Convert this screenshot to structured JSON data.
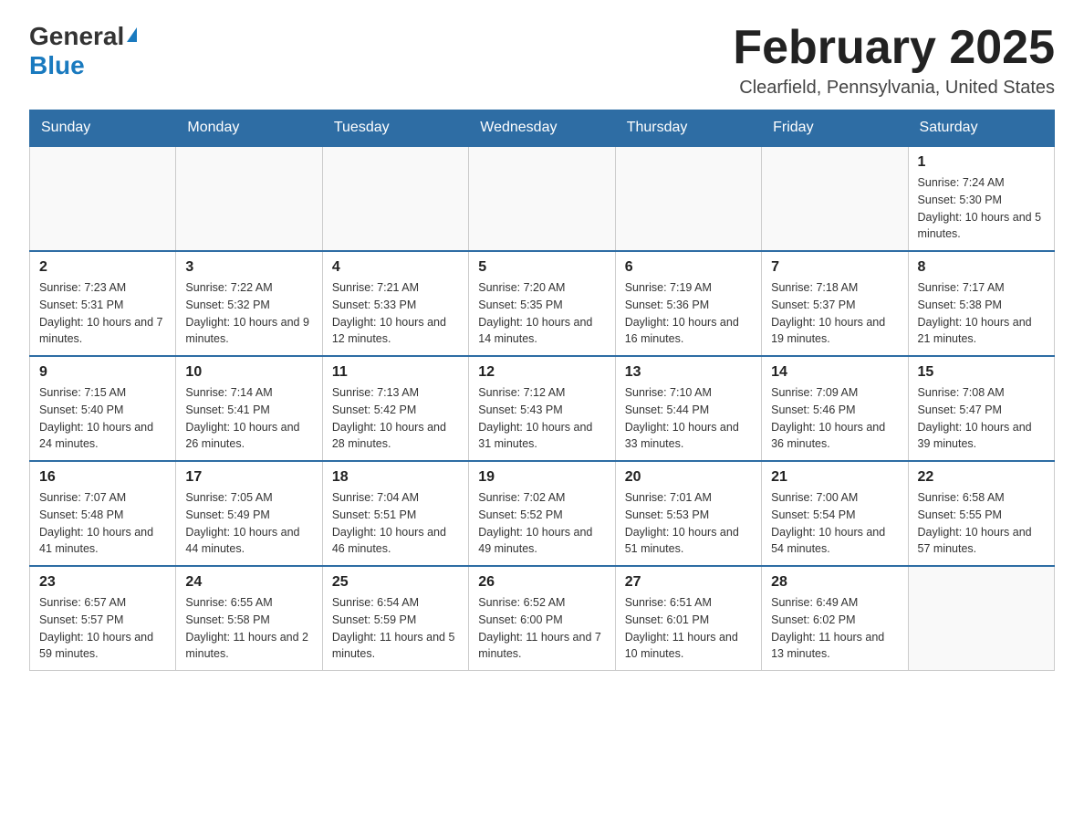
{
  "header": {
    "logo": {
      "general": "General",
      "blue": "Blue",
      "arrow_alt": "arrow"
    },
    "title": "February 2025",
    "location": "Clearfield, Pennsylvania, United States"
  },
  "calendar": {
    "days_of_week": [
      "Sunday",
      "Monday",
      "Tuesday",
      "Wednesday",
      "Thursday",
      "Friday",
      "Saturday"
    ],
    "weeks": [
      [
        {
          "day": "",
          "info": ""
        },
        {
          "day": "",
          "info": ""
        },
        {
          "day": "",
          "info": ""
        },
        {
          "day": "",
          "info": ""
        },
        {
          "day": "",
          "info": ""
        },
        {
          "day": "",
          "info": ""
        },
        {
          "day": "1",
          "info": "Sunrise: 7:24 AM\nSunset: 5:30 PM\nDaylight: 10 hours and 5 minutes."
        }
      ],
      [
        {
          "day": "2",
          "info": "Sunrise: 7:23 AM\nSunset: 5:31 PM\nDaylight: 10 hours and 7 minutes."
        },
        {
          "day": "3",
          "info": "Sunrise: 7:22 AM\nSunset: 5:32 PM\nDaylight: 10 hours and 9 minutes."
        },
        {
          "day": "4",
          "info": "Sunrise: 7:21 AM\nSunset: 5:33 PM\nDaylight: 10 hours and 12 minutes."
        },
        {
          "day": "5",
          "info": "Sunrise: 7:20 AM\nSunset: 5:35 PM\nDaylight: 10 hours and 14 minutes."
        },
        {
          "day": "6",
          "info": "Sunrise: 7:19 AM\nSunset: 5:36 PM\nDaylight: 10 hours and 16 minutes."
        },
        {
          "day": "7",
          "info": "Sunrise: 7:18 AM\nSunset: 5:37 PM\nDaylight: 10 hours and 19 minutes."
        },
        {
          "day": "8",
          "info": "Sunrise: 7:17 AM\nSunset: 5:38 PM\nDaylight: 10 hours and 21 minutes."
        }
      ],
      [
        {
          "day": "9",
          "info": "Sunrise: 7:15 AM\nSunset: 5:40 PM\nDaylight: 10 hours and 24 minutes."
        },
        {
          "day": "10",
          "info": "Sunrise: 7:14 AM\nSunset: 5:41 PM\nDaylight: 10 hours and 26 minutes."
        },
        {
          "day": "11",
          "info": "Sunrise: 7:13 AM\nSunset: 5:42 PM\nDaylight: 10 hours and 28 minutes."
        },
        {
          "day": "12",
          "info": "Sunrise: 7:12 AM\nSunset: 5:43 PM\nDaylight: 10 hours and 31 minutes."
        },
        {
          "day": "13",
          "info": "Sunrise: 7:10 AM\nSunset: 5:44 PM\nDaylight: 10 hours and 33 minutes."
        },
        {
          "day": "14",
          "info": "Sunrise: 7:09 AM\nSunset: 5:46 PM\nDaylight: 10 hours and 36 minutes."
        },
        {
          "day": "15",
          "info": "Sunrise: 7:08 AM\nSunset: 5:47 PM\nDaylight: 10 hours and 39 minutes."
        }
      ],
      [
        {
          "day": "16",
          "info": "Sunrise: 7:07 AM\nSunset: 5:48 PM\nDaylight: 10 hours and 41 minutes."
        },
        {
          "day": "17",
          "info": "Sunrise: 7:05 AM\nSunset: 5:49 PM\nDaylight: 10 hours and 44 minutes."
        },
        {
          "day": "18",
          "info": "Sunrise: 7:04 AM\nSunset: 5:51 PM\nDaylight: 10 hours and 46 minutes."
        },
        {
          "day": "19",
          "info": "Sunrise: 7:02 AM\nSunset: 5:52 PM\nDaylight: 10 hours and 49 minutes."
        },
        {
          "day": "20",
          "info": "Sunrise: 7:01 AM\nSunset: 5:53 PM\nDaylight: 10 hours and 51 minutes."
        },
        {
          "day": "21",
          "info": "Sunrise: 7:00 AM\nSunset: 5:54 PM\nDaylight: 10 hours and 54 minutes."
        },
        {
          "day": "22",
          "info": "Sunrise: 6:58 AM\nSunset: 5:55 PM\nDaylight: 10 hours and 57 minutes."
        }
      ],
      [
        {
          "day": "23",
          "info": "Sunrise: 6:57 AM\nSunset: 5:57 PM\nDaylight: 10 hours and 59 minutes."
        },
        {
          "day": "24",
          "info": "Sunrise: 6:55 AM\nSunset: 5:58 PM\nDaylight: 11 hours and 2 minutes."
        },
        {
          "day": "25",
          "info": "Sunrise: 6:54 AM\nSunset: 5:59 PM\nDaylight: 11 hours and 5 minutes."
        },
        {
          "day": "26",
          "info": "Sunrise: 6:52 AM\nSunset: 6:00 PM\nDaylight: 11 hours and 7 minutes."
        },
        {
          "day": "27",
          "info": "Sunrise: 6:51 AM\nSunset: 6:01 PM\nDaylight: 11 hours and 10 minutes."
        },
        {
          "day": "28",
          "info": "Sunrise: 6:49 AM\nSunset: 6:02 PM\nDaylight: 11 hours and 13 minutes."
        },
        {
          "day": "",
          "info": ""
        }
      ]
    ]
  }
}
